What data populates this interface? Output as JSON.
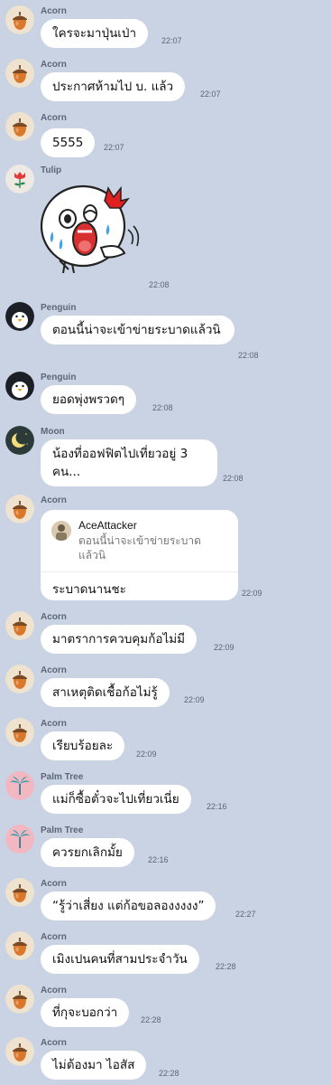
{
  "messages": [
    {
      "sender": "Acorn",
      "avatar": "acorn-icon",
      "text": "ใครจะมาปุ่นเป่า",
      "time": "22:07"
    },
    {
      "sender": "Acorn",
      "avatar": "acorn-icon",
      "text": "ประกาศห้ามไป บ. แล้ว",
      "time": "22:07"
    },
    {
      "sender": "Acorn",
      "avatar": "acorn-icon",
      "text": "5555",
      "time": "22:07"
    },
    {
      "sender": "Tulip",
      "avatar": "tulip-icon",
      "sticker": "crying-character-sticker",
      "time": "22:08"
    },
    {
      "sender": "Penguin",
      "avatar": "penguin-icon",
      "text": "ตอนนี้น่าจะเข้าข่ายระบาดแล้วนิ",
      "time": "22:08"
    },
    {
      "sender": "Penguin",
      "avatar": "penguin-icon",
      "text": "ยอดพุ่งพรวดๆ",
      "time": "22:08"
    },
    {
      "sender": "Moon",
      "avatar": "moon-icon",
      "text": "น้องที่ออฟฟิตไปเที่ยวอยู่ 3 คน...",
      "time": "22:08"
    },
    {
      "sender": "Acorn",
      "avatar": "acorn-icon",
      "reply_to": {
        "name": "AceAttacker",
        "text": "ตอนนี้น่าจะเข้าข่ายระบาดแล้วนิ"
      },
      "text": "ระบาดนานชะ",
      "time": "22:09"
    },
    {
      "sender": "Acorn",
      "avatar": "acorn-icon",
      "text": "มาตราการควบคุมก้อไม่มี",
      "time": "22:09"
    },
    {
      "sender": "Acorn",
      "avatar": "acorn-icon",
      "text": "สาเหตุติดเชื้อก้อไม่รู้",
      "time": "22:09"
    },
    {
      "sender": "Acorn",
      "avatar": "acorn-icon",
      "text": "เรียบร้อยละ",
      "time": "22:09"
    },
    {
      "sender": "Palm Tree",
      "avatar": "palm-tree-icon",
      "text": "แม่ก็ซื้อตั๋วจะไปเที่ยวเนี่ย",
      "time": "22:16"
    },
    {
      "sender": "Palm Tree",
      "avatar": "palm-tree-icon",
      "text": "ควรยกเลิกมั้ย",
      "time": "22:16"
    },
    {
      "sender": "Acorn",
      "avatar": "acorn-icon",
      "text": "“รู้ว่าเสี่ยง แต่ก้อขอลองงงงง”",
      "time": "22:27"
    },
    {
      "sender": "Acorn",
      "avatar": "acorn-icon",
      "text": "เมิงเปนคนที่สามประจำวัน",
      "time": "22:28"
    },
    {
      "sender": "Acorn",
      "avatar": "acorn-icon",
      "text": "ที่กุจะบอกว่า",
      "time": "22:28"
    },
    {
      "sender": "Acorn",
      "avatar": "acorn-icon",
      "text": "ไม่ต้องมา ไอสัส",
      "time": "22:28"
    }
  ]
}
